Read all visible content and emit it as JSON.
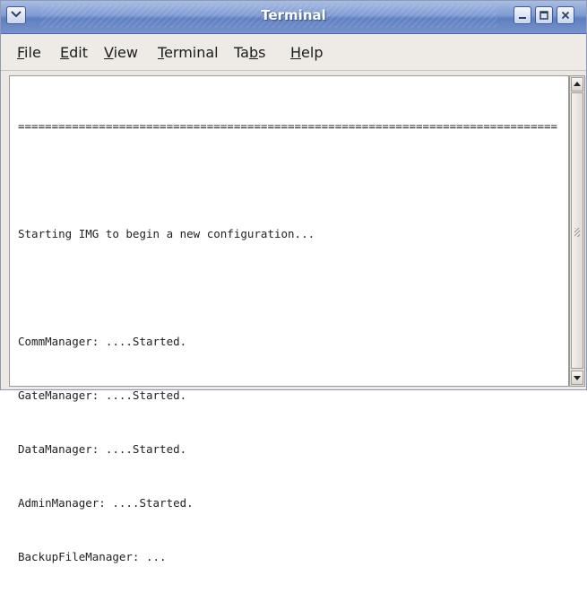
{
  "window": {
    "title": "Terminal"
  },
  "menu": {
    "items": [
      {
        "label": "File",
        "mnemonic": "F"
      },
      {
        "label": "Edit",
        "mnemonic": "E"
      },
      {
        "label": "View",
        "mnemonic": "V"
      },
      {
        "label": "Terminal",
        "mnemonic": "T"
      },
      {
        "label": "Tabs",
        "mnemonic": "b"
      },
      {
        "label": "Help",
        "mnemonic": "H"
      }
    ]
  },
  "terminal": {
    "lines": [
      "================================================================================",
      "",
      "Starting IMG to begin a new configuration...",
      "",
      "CommManager: ....Started.",
      "GateManager: ....Started.",
      "DataManager: ....Started.",
      "AdminManager: ....Started.",
      "BackupFileManager: ..."
    ]
  },
  "icons": {
    "window_menu": "chevron-down-icon",
    "minimize": "minimize-icon",
    "maximize": "maximize-icon",
    "close": "close-icon",
    "scroll_up": "arrow-up-icon",
    "scroll_down": "arrow-down-icon"
  },
  "colors": {
    "titlebar": "#7e9ad1",
    "window_bg": "#ece9e4",
    "terminal_bg": "#ffffff",
    "terminal_text": "#222222"
  }
}
